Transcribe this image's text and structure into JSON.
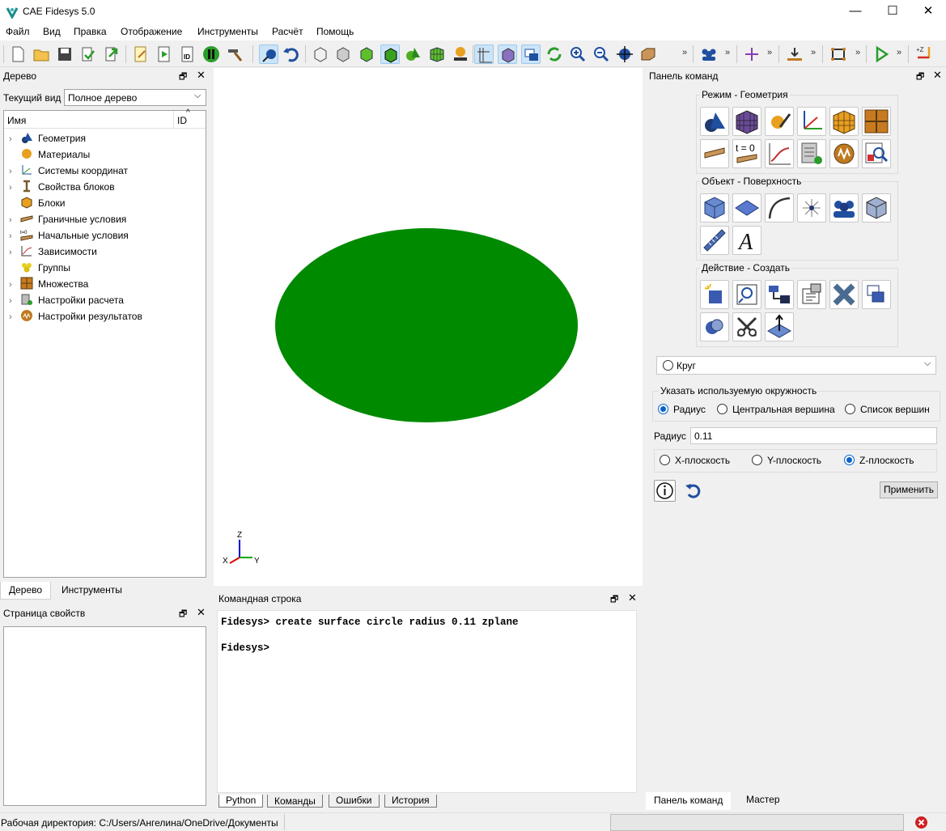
{
  "window": {
    "title": "CAE Fidesys 5.0",
    "minimize": "—",
    "maximize": "☐",
    "close": "✕"
  },
  "menu": [
    "Файл",
    "Вид",
    "Правка",
    "Отображение",
    "Инструменты",
    "Расчёт",
    "Помощь"
  ],
  "tree_panel": {
    "title": "Дерево",
    "view_label": "Текущий вид",
    "view_value": "Полное дерево",
    "col_name": "Имя",
    "col_id": "ID",
    "items": [
      {
        "label": "Геометрия",
        "icon": "geometry-icon",
        "expandable": true
      },
      {
        "label": "Материалы",
        "icon": "materials-icon",
        "expandable": false
      },
      {
        "label": "Системы координат",
        "icon": "coordinate-systems-icon",
        "expandable": true
      },
      {
        "label": "Свойства блоков",
        "icon": "block-properties-icon",
        "expandable": true
      },
      {
        "label": "Блоки",
        "icon": "blocks-icon",
        "expandable": false
      },
      {
        "label": "Граничные условия",
        "icon": "boundary-conditions-icon",
        "expandable": true
      },
      {
        "label": "Начальные условия",
        "icon": "initial-conditions-icon",
        "expandable": true
      },
      {
        "label": "Зависимости",
        "icon": "dependencies-icon",
        "expandable": true
      },
      {
        "label": "Группы",
        "icon": "groups-icon",
        "expandable": false
      },
      {
        "label": "Множества",
        "icon": "sets-icon",
        "expandable": true
      },
      {
        "label": "Настройки расчета",
        "icon": "calc-settings-icon",
        "expandable": true
      },
      {
        "label": "Настройки результатов",
        "icon": "result-settings-icon",
        "expandable": true
      }
    ],
    "tabs": [
      "Дерево",
      "Инструменты"
    ]
  },
  "properties_panel": {
    "title": "Страница свойств"
  },
  "viewport": {
    "shape_color": "#008a00",
    "axes": {
      "z": "Z",
      "y": "Y",
      "x": "X"
    }
  },
  "command_line": {
    "title": "Командная строка",
    "lines": [
      "Fidesys> create surface circle radius 0.11 zplane",
      "Fidesys>"
    ],
    "tabs": [
      "Python",
      "Команды",
      "Ошибки",
      "История"
    ]
  },
  "command_panel": {
    "title": "Панель команд",
    "mode_title": "Режим - Геометрия",
    "t0_label": "t = 0",
    "object_title": "Объект - Поверхность",
    "action_title": "Действие - Создать",
    "shape_select": "Круг",
    "circle_group_title": "Указать используемую окружность",
    "circle_options": [
      "Радиус",
      "Центральная вершина",
      "Список вершин"
    ],
    "radius_label": "Радиус",
    "radius_value": "0.11",
    "plane_options": [
      "X-плоскость",
      "Y-плоскость",
      "Z-плоскость"
    ],
    "apply_label": "Применить",
    "tabs": [
      "Панель команд",
      "Мастер"
    ]
  },
  "status_bar": {
    "working_dir": "Рабочая директория: C:/Users/Ангелина/OneDrive/Документы"
  }
}
